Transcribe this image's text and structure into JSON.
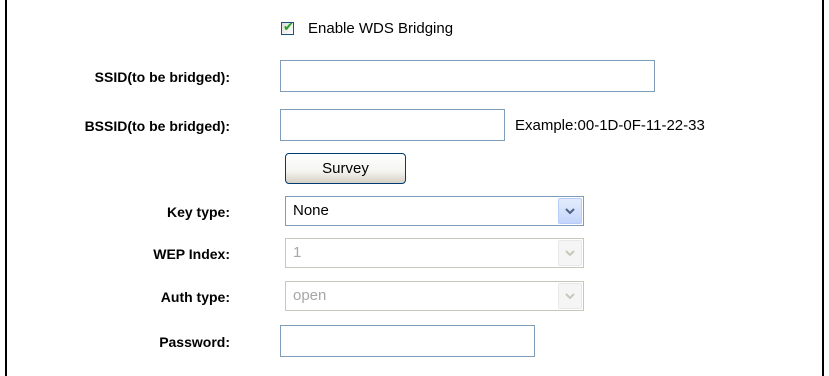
{
  "wds": {
    "enable_label": "Enable WDS Bridging",
    "enabled": true
  },
  "fields": {
    "ssid_label": "SSID(to be bridged):",
    "ssid_value": "",
    "bssid_label": "BSSID(to be bridged):",
    "bssid_value": "",
    "bssid_example": "Example:00-1D-0F-11-22-33",
    "survey_button": "Survey",
    "key_type_label": "Key type:",
    "key_type_value": "None",
    "wep_index_label": "WEP Index:",
    "wep_index_value": "1",
    "auth_type_label": "Auth type:",
    "auth_type_value": "open",
    "password_label": "Password:",
    "password_value": ""
  },
  "colors": {
    "checkmark": "#21a121",
    "input_border": "#7f9db9",
    "disabled_text": "#a7a6aa"
  },
  "icons": {
    "dropdown": "chevron-down-icon"
  }
}
